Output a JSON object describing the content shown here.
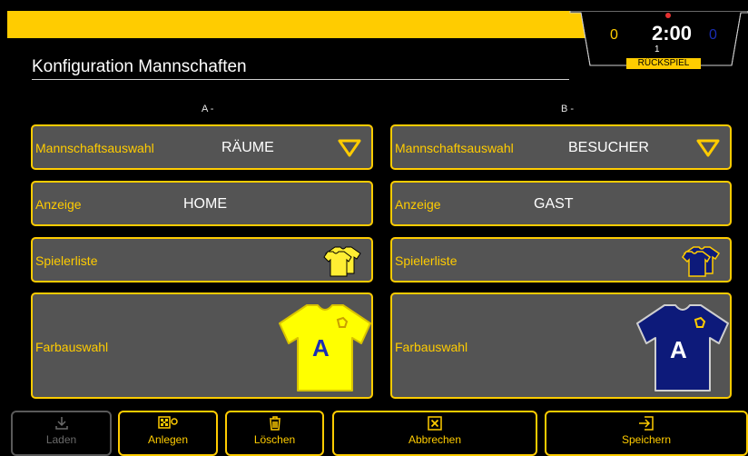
{
  "header": {
    "score_home": "0",
    "score_guest": "0",
    "clock": "2:00",
    "period": "1",
    "phase": "RÜCKSPIEL",
    "accent": "#ffcc00"
  },
  "page": {
    "title": "Konfiguration Mannschaften"
  },
  "teams": [
    {
      "column_label": "A -",
      "team_select_label": "Mannschaftsauswahl",
      "team_select_value": "RÄUME",
      "display_label": "Anzeige",
      "display_value": "HOME",
      "player_list_label": "Spielerliste",
      "color_label": "Farbauswahl",
      "jersey_letter": "A",
      "jersey_color": "#ffff00"
    },
    {
      "column_label": "B -",
      "team_select_label": "Mannschaftsauswahl",
      "team_select_value": "BESUCHER",
      "display_label": "Anzeige",
      "display_value": "GAST",
      "player_list_label": "Spielerliste",
      "color_label": "Farbauswahl",
      "jersey_letter": "A",
      "jersey_color": "#0d1a7a"
    }
  ],
  "toolbar": {
    "load_label": "Laden",
    "create_label": "Anlegen",
    "delete_label": "Löschen",
    "cancel_label": "Abbrechen",
    "save_label": "Speichern"
  },
  "icons": {
    "dropdown": "chevron-down-triangle-icon",
    "players": "jerseys-icon",
    "load": "download-icon",
    "create": "grid-add-icon",
    "delete": "trash-icon",
    "cancel": "close-box-icon",
    "save": "login-arrow-icon"
  }
}
